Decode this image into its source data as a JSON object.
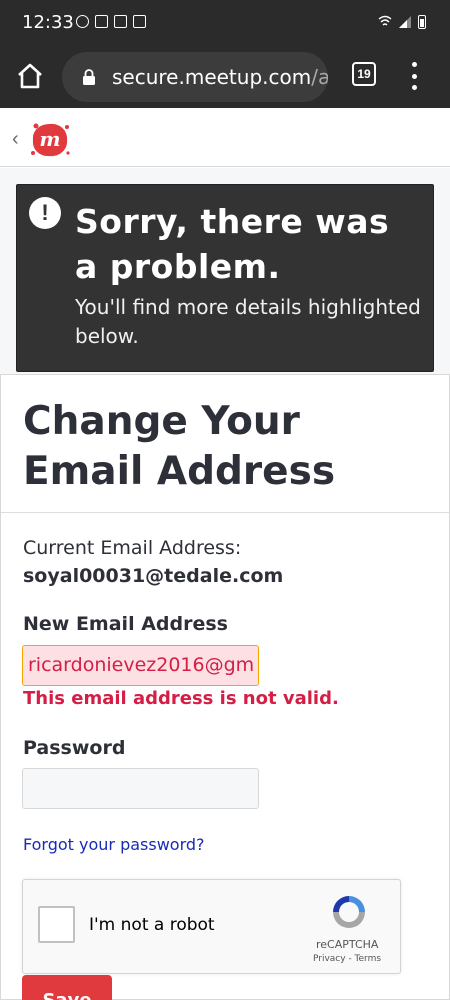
{
  "status_bar": {
    "time": "12:33"
  },
  "browser": {
    "url_host": "secure.meetup.com",
    "url_rest": "/ac",
    "tab_count": "19"
  },
  "error_banner": {
    "title": "Sorry, there was a problem.",
    "body": "You'll find more details highlighted below."
  },
  "form": {
    "title": "Change Your Email Address",
    "current_email_label": "Current Email Address:",
    "current_email_value": "soyal00031@tedale.com",
    "new_email_label": "New Email Address",
    "new_email_value": "ricardonievez2016@gm",
    "new_email_error": "This email address is not valid.",
    "password_label": "Password",
    "password_value": "",
    "forgot_link": "Forgot your password?",
    "save_label": "Save"
  },
  "recaptcha": {
    "label": "I'm not a robot",
    "brand": "reCAPTCHA",
    "links": "Privacy - Terms"
  },
  "colors": {
    "error_red": "#d41e45",
    "brand_red": "#e0393e",
    "link_blue": "#1a2bb5",
    "banner_bg": "#333333"
  }
}
